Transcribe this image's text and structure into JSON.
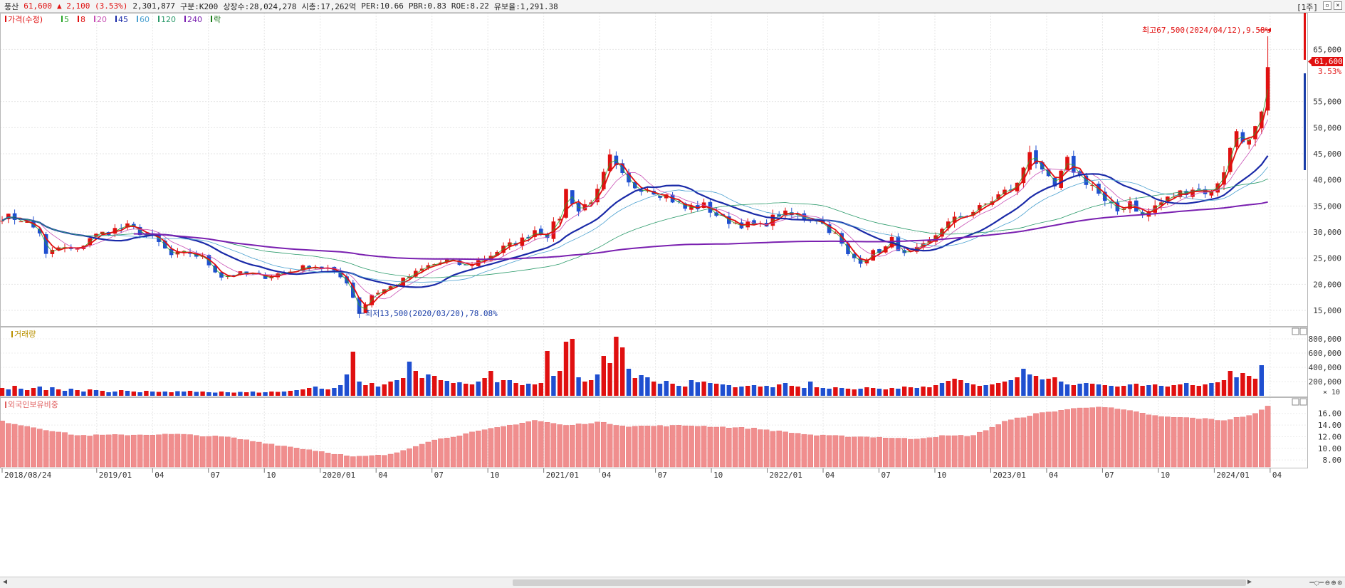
{
  "header": {
    "name": "풍산",
    "price": "61,600",
    "change": "▲ 2,100 (3.53%)",
    "volume": "2,301,877",
    "category": "구분:K200",
    "shares": "상장수:28,024,278",
    "market_cap": "시총:17,262억",
    "per": "PER:10.66",
    "pbr": "PBR:0.83",
    "roe": "ROE:8.22",
    "float_rate": "유보율:1,291.38",
    "period_button": "[1주]"
  },
  "legend": {
    "price_label": "가격(수정)",
    "ma_labels": [
      "5",
      "8",
      "20",
      "45",
      "60",
      "120",
      "240"
    ],
    "ma_colors": [
      "#2aa52a",
      "#e01010",
      "#c84fb4",
      "#1a2aa8",
      "#4aa0d0",
      "#2a9a6a",
      "#7a20b0"
    ],
    "last_label": "락"
  },
  "annotations": {
    "high": "최고67,500(2024/04/12),9.58%",
    "low": "최저13,500(2020/03/20),78.08%",
    "last_price": "61,600",
    "last_pct": "3.53%"
  },
  "volume_panel": {
    "title": "거래량",
    "unit": "× 10"
  },
  "foreign_panel": {
    "title": "외국인보유비중"
  },
  "chart_data": [
    {
      "type": "candlestick",
      "title": "",
      "x_labels": [
        "2018/08/24",
        "2019/01",
        "04",
        "07",
        "10",
        "2020/01",
        "04",
        "07",
        "10",
        "2021/01",
        "04",
        "07",
        "10",
        "2022/01",
        "04",
        "07",
        "10",
        "2023/01",
        "04",
        "07",
        "10",
        "2024/01",
        "04"
      ],
      "yticks": [
        15000,
        20000,
        25000,
        30000,
        35000,
        40000,
        45000,
        50000,
        55000,
        65000
      ],
      "ylim": [
        12000,
        72000
      ],
      "close_keypoints": [
        [
          0,
          33000
        ],
        [
          3,
          32500
        ],
        [
          6,
          30000
        ],
        [
          7,
          25500
        ],
        [
          9,
          27000
        ],
        [
          12,
          26500
        ],
        [
          14,
          29000
        ],
        [
          18,
          30500
        ],
        [
          20,
          31000
        ],
        [
          24,
          29000
        ],
        [
          27,
          25500
        ],
        [
          30,
          26000
        ],
        [
          32,
          25000
        ],
        [
          35,
          21500
        ],
        [
          38,
          22000
        ],
        [
          42,
          21500
        ],
        [
          46,
          22500
        ],
        [
          49,
          23500
        ],
        [
          52,
          23000
        ],
        [
          55,
          20500
        ],
        [
          57,
          14500
        ],
        [
          59,
          18000
        ],
        [
          62,
          19500
        ],
        [
          65,
          21500
        ],
        [
          68,
          23500
        ],
        [
          71,
          24500
        ],
        [
          74,
          23500
        ],
        [
          77,
          25000
        ],
        [
          80,
          27000
        ],
        [
          83,
          28500
        ],
        [
          85,
          30500
        ],
        [
          87,
          29500
        ],
        [
          89,
          33000
        ],
        [
          90,
          38000
        ],
        [
          92,
          34000
        ],
        [
          95,
          37500
        ],
        [
          97,
          44000
        ],
        [
          98,
          42000
        ],
        [
          100,
          39000
        ],
        [
          103,
          38500
        ],
        [
          106,
          37000
        ],
        [
          109,
          34500
        ],
        [
          112,
          35000
        ],
        [
          115,
          32500
        ],
        [
          118,
          31500
        ],
        [
          121,
          31000
        ],
        [
          124,
          33500
        ],
        [
          127,
          33000
        ],
        [
          130,
          32500
        ],
        [
          133,
          29500
        ],
        [
          135,
          25500
        ],
        [
          137,
          24500
        ],
        [
          139,
          26000
        ],
        [
          141,
          27000
        ],
        [
          142,
          28500
        ],
        [
          144,
          25500
        ],
        [
          146,
          26500
        ],
        [
          148,
          28000
        ],
        [
          150,
          31000
        ],
        [
          153,
          33000
        ],
        [
          156,
          34500
        ],
        [
          159,
          37000
        ],
        [
          162,
          39000
        ],
        [
          164,
          46000
        ],
        [
          166,
          41000
        ],
        [
          168,
          38500
        ],
        [
          170,
          43500
        ],
        [
          172,
          40500
        ],
        [
          174,
          39000
        ],
        [
          176,
          35500
        ],
        [
          178,
          34000
        ],
        [
          180,
          36000
        ],
        [
          182,
          33000
        ],
        [
          184,
          35000
        ],
        [
          187,
          37000
        ],
        [
          190,
          38500
        ],
        [
          193,
          37500
        ],
        [
          195,
          42000
        ],
        [
          197,
          49500
        ],
        [
          199,
          47000
        ],
        [
          201,
          52000
        ],
        [
          202,
          61600
        ]
      ],
      "annotations": {
        "high": 67500,
        "low": 13500,
        "last": 61600
      }
    },
    {
      "type": "bar",
      "title": "",
      "yticks": [
        200000,
        400000,
        600000,
        800000
      ],
      "ylim": [
        0,
        880000
      ],
      "values": [
        110000,
        90000,
        140000,
        100000,
        80000,
        110000,
        130000,
        80000,
        120000,
        90000,
        70000,
        100000,
        80000,
        60000,
        90000,
        80000,
        70000,
        50000,
        60000,
        80000,
        70000,
        60000,
        50000,
        70000,
        60000,
        55000,
        60000,
        50000,
        65000,
        60000,
        70000,
        55000,
        60000,
        50000,
        45000,
        60000,
        50000,
        45000,
        55000,
        50000,
        60000,
        45000,
        50000,
        60000,
        55000,
        60000,
        70000,
        80000,
        90000,
        110000,
        130000,
        100000,
        90000,
        110000,
        150000,
        300000,
        620000,
        200000,
        150000,
        180000,
        130000,
        160000,
        200000,
        220000,
        250000,
        480000,
        350000,
        250000,
        300000,
        280000,
        220000,
        210000,
        180000,
        190000,
        170000,
        160000,
        200000,
        250000,
        350000,
        190000,
        220000,
        220000,
        180000,
        150000,
        170000,
        160000,
        180000,
        630000,
        280000,
        350000,
        760000,
        800000,
        260000,
        200000,
        220000,
        300000,
        560000,
        460000,
        830000,
        680000,
        380000,
        250000,
        290000,
        260000,
        200000,
        170000,
        210000,
        170000,
        140000,
        130000,
        220000,
        190000,
        200000,
        180000,
        170000,
        160000,
        150000,
        120000,
        130000,
        140000,
        150000,
        130000,
        140000,
        120000,
        160000,
        180000,
        140000,
        130000,
        110000,
        200000,
        120000,
        110000,
        100000,
        120000,
        110000,
        100000,
        90000,
        100000,
        120000,
        110000,
        100000,
        90000,
        110000,
        100000,
        130000,
        120000,
        110000,
        130000,
        120000,
        150000,
        180000,
        210000,
        240000,
        220000,
        180000,
        160000,
        140000,
        150000,
        160000,
        180000,
        200000,
        220000,
        260000,
        380000,
        300000,
        280000,
        230000,
        240000,
        260000,
        200000,
        160000,
        150000,
        170000,
        180000,
        170000,
        160000,
        150000,
        140000,
        130000,
        140000,
        160000,
        170000,
        140000,
        150000,
        160000,
        140000,
        130000,
        150000,
        160000,
        180000,
        150000,
        140000,
        160000,
        180000,
        190000,
        220000,
        350000,
        260000,
        320000,
        280000,
        240000,
        430000
      ],
      "up": [
        1,
        0,
        1,
        0,
        1,
        1,
        0,
        1,
        0,
        1,
        0,
        0,
        1,
        0,
        1,
        0,
        1,
        0,
        0,
        1,
        0,
        1,
        0,
        1,
        0,
        1,
        0,
        1,
        0,
        0,
        1,
        0,
        1,
        0,
        0,
        1,
        0,
        1,
        0,
        1,
        0,
        1,
        0,
        1,
        1,
        0,
        1,
        0,
        1,
        1,
        0,
        0,
        1,
        0,
        0,
        0,
        1,
        0,
        1,
        1,
        0,
        1,
        1,
        0,
        1,
        0,
        1,
        1,
        0,
        1,
        1,
        0,
        1,
        0,
        1,
        1,
        0,
        1,
        1,
        0,
        1,
        0,
        1,
        1,
        0,
        1,
        1,
        1,
        0,
        1,
        1,
        1,
        0,
        1,
        1,
        0,
        1,
        1,
        1,
        1,
        0,
        1,
        0,
        0,
        1,
        0,
        0,
        1,
        0,
        1,
        0,
        0,
        1,
        0,
        1,
        0,
        0,
        1,
        0,
        1,
        0,
        1,
        0,
        0,
        1,
        0,
        1,
        1,
        0,
        0,
        1,
        0,
        0,
        1,
        0,
        1,
        1,
        0,
        1,
        1,
        0,
        1,
        1,
        0,
        1,
        1,
        0,
        1,
        1,
        1,
        0,
        1,
        1,
        1,
        0,
        1,
        1,
        0,
        1,
        1,
        1,
        0,
        1,
        0,
        0,
        1,
        0,
        1,
        1,
        0,
        0,
        1,
        0,
        0,
        1,
        0,
        1,
        0,
        1,
        1,
        0,
        1,
        1,
        0,
        1,
        0,
        1,
        1,
        1,
        0,
        1,
        1,
        1,
        0,
        1,
        1,
        1,
        0,
        1,
        1,
        1,
        0,
        1
      ]
    },
    {
      "type": "bar",
      "title": "",
      "yticks": [
        8.0,
        10.0,
        12.0,
        14.0,
        16.0
      ],
      "ylim": [
        6.8,
        17.8
      ],
      "keypoints": [
        [
          0,
          14.6
        ],
        [
          12,
          12.2
        ],
        [
          28,
          12.4
        ],
        [
          36,
          11.9
        ],
        [
          45,
          10.4
        ],
        [
          52,
          9.3
        ],
        [
          56,
          8.5
        ],
        [
          62,
          8.9
        ],
        [
          68,
          11.2
        ],
        [
          75,
          12.7
        ],
        [
          85,
          14.8
        ],
        [
          90,
          13.9
        ],
        [
          95,
          14.5
        ],
        [
          100,
          13.8
        ],
        [
          110,
          13.9
        ],
        [
          120,
          13.4
        ],
        [
          130,
          12.2
        ],
        [
          140,
          11.9
        ],
        [
          145,
          11.6
        ],
        [
          150,
          12.1
        ],
        [
          155,
          12.2
        ],
        [
          160,
          14.6
        ],
        [
          165,
          15.9
        ],
        [
          170,
          16.7
        ],
        [
          175,
          17.2
        ],
        [
          180,
          16.4
        ],
        [
          185,
          15.4
        ],
        [
          190,
          15.2
        ],
        [
          195,
          14.8
        ],
        [
          200,
          15.9
        ],
        [
          202,
          17.2
        ]
      ]
    }
  ]
}
